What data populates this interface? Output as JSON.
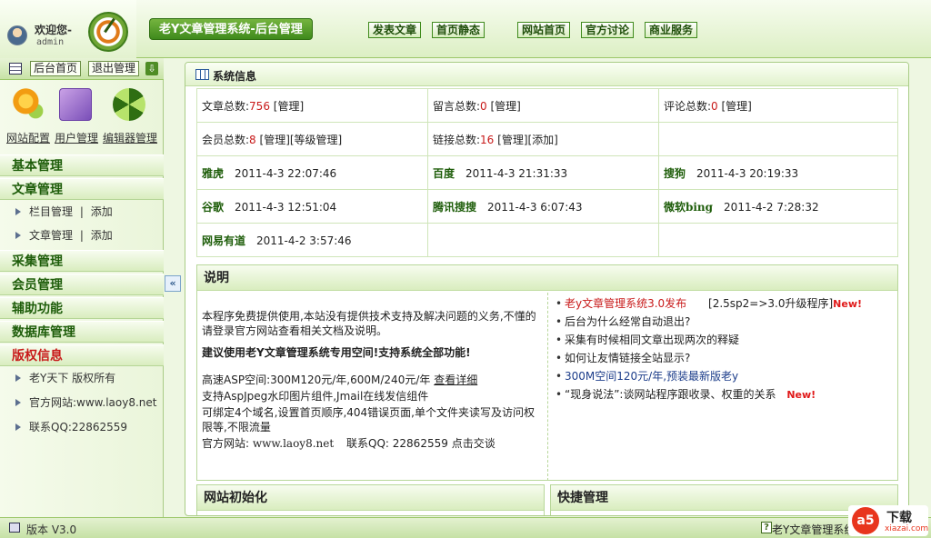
{
  "header": {
    "welcome": "欢迎您-",
    "username": "admin",
    "system_title": "老Y文章管理系统-后台管理",
    "nav": [
      "发表文章",
      "首页静态",
      "网站首页",
      "官方讨论",
      "商业服务"
    ]
  },
  "sidebar": {
    "top_buttons": [
      "后台首页",
      "退出管理"
    ],
    "tools": [
      "网站配置",
      "用户管理",
      "编辑器管理"
    ],
    "menu": {
      "basic": "基本管理",
      "article": "文章管理",
      "article_items": [
        {
          "label": "栏目管理",
          "sep": "|",
          "action": "添加"
        },
        {
          "label": "文章管理",
          "sep": "|",
          "action": "添加"
        }
      ],
      "collect": "采集管理",
      "member": "会员管理",
      "assist": "辅助功能",
      "database": "数据库管理",
      "copyright": "版权信息",
      "copyright_items": [
        "老Y天下 版权所有",
        "官方网站:www.laoy8.net",
        "联系QQ:22862559"
      ]
    }
  },
  "main": {
    "title": "系统信息",
    "stats": {
      "article_label": "文章总数:",
      "article_count": "756",
      "article_link": "[管理]",
      "message_label": "留言总数:",
      "message_count": "0",
      "message_link": "[管理]",
      "comment_label": "评论总数:",
      "comment_count": "0",
      "comment_link": "[管理]",
      "member_label": "会员总数:",
      "member_count": "8",
      "member_link": "[管理][等级管理]",
      "link_label": "链接总数:",
      "link_count": "16",
      "link_link": "[管理][添加]"
    },
    "engines": [
      {
        "name": "雅虎",
        "time": "2011-4-3 22:07:46"
      },
      {
        "name": "百度",
        "time": "2011-4-3 21:31:33"
      },
      {
        "name": "搜狗",
        "time": "2011-4-3 20:19:33"
      },
      {
        "name": "谷歌",
        "time": "2011-4-3 12:51:04"
      },
      {
        "name": "腾讯搜搜",
        "time": "2011-4-3 6:07:43"
      },
      {
        "name": "微软bing",
        "time": "2011-4-2 7:28:32"
      },
      {
        "name": "网易有道",
        "time": "2011-4-2 3:57:46"
      }
    ],
    "desc": {
      "title": "说明",
      "intro": "本程序免费提供使用,本站没有提供技术支持及解决问题的义务,不懂的请登录官方网站查看相关文档及说明。",
      "recommend": "建议使用老Y文章管理系统专用空间!支持系统全部功能!",
      "hosting": "高速ASP空间:300M120元/年,600M/240元/年",
      "hosting_link": "查看详细",
      "line2": "支持AspJpeg水印图片组件,Jmail在线发信组件",
      "line3": "可绑定4个域名,设置首页顺序,404错误页面,单个文件夹读写及访问权限等,不限流量",
      "site_label": "官方网站:",
      "site": "www.laoy8.net",
      "qq_label": "联系QQ:",
      "qq": "22862559",
      "talk_link": "点击交谈"
    },
    "news": [
      {
        "text": "老y文章管理系统3.0发布",
        "extra": "[2.5sp2=>3.0升级程序]",
        "new": "New!"
      },
      {
        "text": "后台为什么经常自动退出?"
      },
      {
        "text": "采集有时候相同文章出现两次的释疑"
      },
      {
        "text": "如何让友情链接全站显示?"
      },
      {
        "text": "300M空间120元/年,预装最新版老y"
      },
      {
        "text": "“现身说法”:谈网站程序跟收录、权重的关系",
        "new": "New!"
      }
    ],
    "init_title": "网站初始化",
    "quick_title": "快捷管理"
  },
  "footer": {
    "version": "版本 V3.0",
    "copyright": "老Y文章管理系统"
  },
  "watermark": {
    "logo": "a5",
    "text": "下载",
    "site": "xiazai.com"
  },
  "colors": {
    "accent_green": "#3f8a1c",
    "count_red": "#c81a1a",
    "news_red": "#c81a1a",
    "news_blue": "#1c3d8a"
  }
}
